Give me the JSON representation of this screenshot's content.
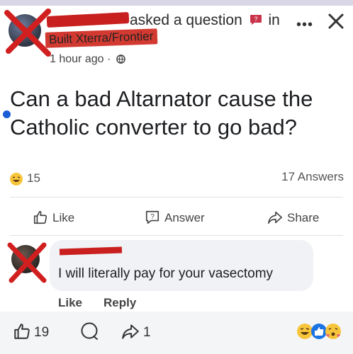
{
  "post": {
    "asked_text": "asked a question",
    "in_text": "in",
    "group_name": "Built Xterra/Frontier",
    "time": "1 hour ago ·",
    "question": "Can a bad Altarnator cause the Catholic converter to go bad?",
    "reaction_count": "15",
    "answers": "17 Answers"
  },
  "actions": {
    "like": "Like",
    "answer": "Answer",
    "share": "Share"
  },
  "comment": {
    "text": "I will literally pay for your vasectomy",
    "like": "Like",
    "reply": "Reply"
  },
  "bottom_bar": {
    "like_count": "19",
    "share_count": "1"
  },
  "icons": {
    "more": "more-options-icon",
    "close": "close-icon",
    "globe": "globe-icon",
    "question": "question-icon",
    "like": "thumbs-up-icon",
    "answer": "answer-bubble-icon",
    "share": "share-arrow-icon",
    "comment": "comment-icon",
    "reactions": "reaction-emojis-icon"
  },
  "colors": {
    "redaction": "#c7201e",
    "group_pill": "#d23a31",
    "blue_dot": "#1a5bd6",
    "comment_bubble": "#f0f2f5"
  }
}
